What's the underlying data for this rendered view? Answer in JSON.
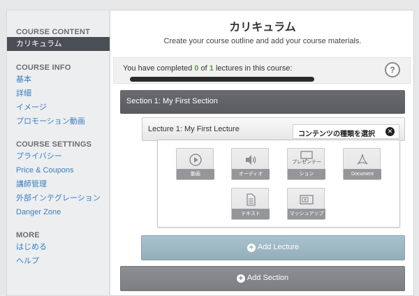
{
  "sidebar": {
    "course_content": {
      "heading": "COURSE CONTENT",
      "items": [
        {
          "label": "カリキュラム",
          "active": true
        }
      ]
    },
    "course_info": {
      "heading": "COURSE INFO",
      "items": [
        {
          "label": "基本"
        },
        {
          "label": "詳細"
        },
        {
          "label": "イメージ"
        },
        {
          "label": "プロモーション動画"
        }
      ]
    },
    "course_settings": {
      "heading": "COURSE SETTINGS",
      "items": [
        {
          "label": "プライバシー"
        },
        {
          "label": "Price & Coupons"
        },
        {
          "label": "講師管理"
        },
        {
          "label": "外部インテグレーション"
        },
        {
          "label": "Danger Zone"
        }
      ]
    },
    "more": {
      "heading": "MORE",
      "items": [
        {
          "label": "はじめる"
        },
        {
          "label": "ヘルプ"
        }
      ]
    }
  },
  "main": {
    "title": "カリキュラム",
    "subtitle": "Create your course outline and add your course materials.",
    "progress": {
      "prefix": "You have completed ",
      "completed": "0",
      "middle": " of ",
      "total": "1",
      "suffix": " lectures in this course:",
      "fraction": 0
    },
    "help_label": "?",
    "section": {
      "label": "Section 1: My First Section"
    },
    "lecture": {
      "label": "Lecture 1: My First Lecture"
    },
    "content_picker": {
      "title": "コンテンツの種類を選択",
      "close_label": "✕",
      "types": [
        {
          "label": "動画",
          "icon": "video-icon"
        },
        {
          "label": "オーディオ",
          "icon": "audio-icon"
        },
        {
          "label_top": "プレゼンテー",
          "label": "ション",
          "icon": "presentation-icon"
        },
        {
          "label": "Document",
          "icon": "document-icon"
        },
        {
          "label": "テキスト",
          "icon": "text-icon"
        },
        {
          "label": "マッシュアップ",
          "icon": "mashup-icon"
        }
      ]
    },
    "add_lecture_label": "Add Lecture",
    "add_section_label": "Add Section"
  },
  "colors": {
    "sidebar_active_bg": "#4a4e55",
    "link": "#3b7fc0",
    "progress_green": "#5a9e2e",
    "section_bar": "#5f6063",
    "add_lecture": "#9db6c2",
    "add_section": "#838487"
  }
}
